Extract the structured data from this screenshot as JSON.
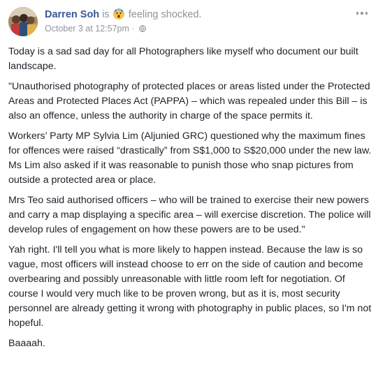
{
  "post": {
    "author": "Darren Soh",
    "is_text": "is",
    "feeling_text": "feeling shocked.",
    "feeling_icon": "shocked-emoji-icon",
    "timestamp": "October 3 at 12:57pm",
    "separator": "·",
    "privacy_icon": "globe-icon",
    "options_icon": "more-options-icon",
    "paragraphs": [
      "Today is a sad sad day for all Photographers like myself who document our built landscape.",
      "\"Unauthorised photography of protected places or areas listed under the Protected Areas and Protected Places Act (PAPPA) – which was repealed under this Bill – is also an offence, unless the authority in charge of the space permits it.",
      "Workers’ Party MP Sylvia Lim (Aljunied GRC) questioned why the maximum fines for offences were raised “drastically” from S$1,000 to S$20,000 under the new law. Ms Lim also asked if it was reasonable to punish those who snap pictures from outside a protected area or place.",
      "Mrs Teo said authorised officers – who will be trained to exercise their new powers and carry a map displaying a specific area – will exercise discretion. The police will develop rules of engagement on how these powers are to be used.\"",
      "Yah right. I'll tell you what is more likely to happen instead. Because the law is so vague, most officers will instead choose to err on the side of caution and become overbearing and possibly unreasonable with little room left for negotiation. Of course I would very much like to be proven wrong, but as it is, most security personnel are already getting it wrong with photography in public places, so I'm not hopeful.",
      "Baaaah."
    ]
  },
  "colors": {
    "author_link": "#365899",
    "meta_gray": "#90949c",
    "body_text": "#1d2129"
  }
}
